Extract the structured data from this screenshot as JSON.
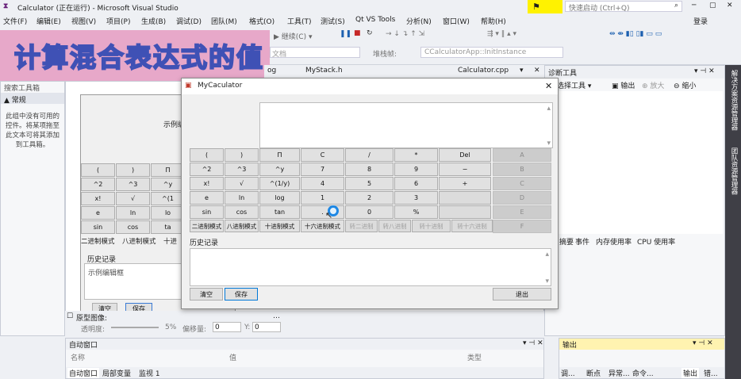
{
  "window": {
    "title": "Calculator (正在运行) - Microsoft Visual Studio",
    "quick_launch": "快速启动 (Ctrl+Q)",
    "signin": "登录"
  },
  "menu": [
    "文件(F)",
    "编辑(E)",
    "视图(V)",
    "项目(P)",
    "生成(B)",
    "调试(D)",
    "团队(M)",
    "格式(O)",
    "工具(T)",
    "测试(S)",
    "Qt VS Tools",
    "分析(N)",
    "窗口(W)",
    "帮助(H)"
  ],
  "toolbar": {
    "continue": "继续(C)",
    "stack_frame": "堆栈帧:",
    "stack_value": "CCalculatorApp::InitInstance",
    "file_frag": "文档"
  },
  "banner": {
    "text": "计算混合表达式的值"
  },
  "tabs": {
    "t1": "og",
    "t2": "MyStack.h",
    "t3": "Calculator.cpp"
  },
  "toolbox": {
    "title": "搜索工具箱",
    "group": "▲ 常规",
    "msg": "此组中没有可用的控件。将某项拖至此文本可将其添加到工具箱。"
  },
  "diag": {
    "title": "诊断工具",
    "select_tool": "选择工具",
    "output": "输出",
    "zoom_in": "放大",
    "zoom_out": "缩小",
    "tabs": [
      "摘要",
      "事件",
      "内存使用率",
      "CPU 使用率"
    ]
  },
  "right_strip": [
    "解决方案资源管理器",
    "团队资源管理器"
  ],
  "designer": {
    "sample": "示例编",
    "history": "历史记录",
    "sample_frame": "示例编辑框",
    "clear": "清空",
    "save": "保存",
    "octal_mode": "二进制模式",
    "oct2": "八进制模式",
    "hex_frag": "十进",
    "buttons": [
      [
        "(",
        ")",
        "П"
      ],
      [
        "^2",
        "^3",
        "^y"
      ],
      [
        "x!",
        "√",
        "^(1"
      ],
      [
        "e",
        "ln",
        "lo"
      ],
      [
        "sin",
        "cos",
        "ta"
      ]
    ]
  },
  "bottom": {
    "proto_label": "原型图像:",
    "transparency": "透明度:",
    "transparency_pct": "5%",
    "offset": "偏移量:",
    "x_val": "0",
    "y_label": "Y:",
    "y_val": "0"
  },
  "autos": {
    "title": "自动窗口",
    "col_name": "名称",
    "col_value": "值",
    "col_type": "类型",
    "tabs": [
      "自动窗口",
      "局部变量",
      "监视 1"
    ]
  },
  "output_panel": {
    "title": "输出",
    "tabs": [
      "调...",
      "断点",
      "异常...",
      "命令...",
      "输出",
      "错..."
    ]
  },
  "dialog": {
    "title": "MyCaculator",
    "rows": [
      [
        "(",
        ")",
        "П",
        "C",
        "/",
        "*",
        "Del"
      ],
      [
        "^2",
        "^3",
        "^y",
        "7",
        "8",
        "9",
        "−"
      ],
      [
        "x!",
        "√",
        "^(1/y)",
        "4",
        "5",
        "6",
        "+"
      ],
      [
        "e",
        "ln",
        "log",
        "1",
        "2",
        "3",
        ""
      ],
      [
        "sin",
        "cos",
        "tan",
        ".",
        "0",
        "%",
        ""
      ]
    ],
    "hex_letters": [
      "A",
      "B",
      "C",
      "D",
      "E",
      "F"
    ],
    "modes": [
      "二进制模式",
      "八进制模式",
      "十进制模式",
      "十六进制模式",
      "转二进制",
      "转八进制",
      "转十进制",
      "转十六进制"
    ],
    "history_label": "历史记录",
    "clear": "清空",
    "save": "保存",
    "quit": "退出"
  }
}
